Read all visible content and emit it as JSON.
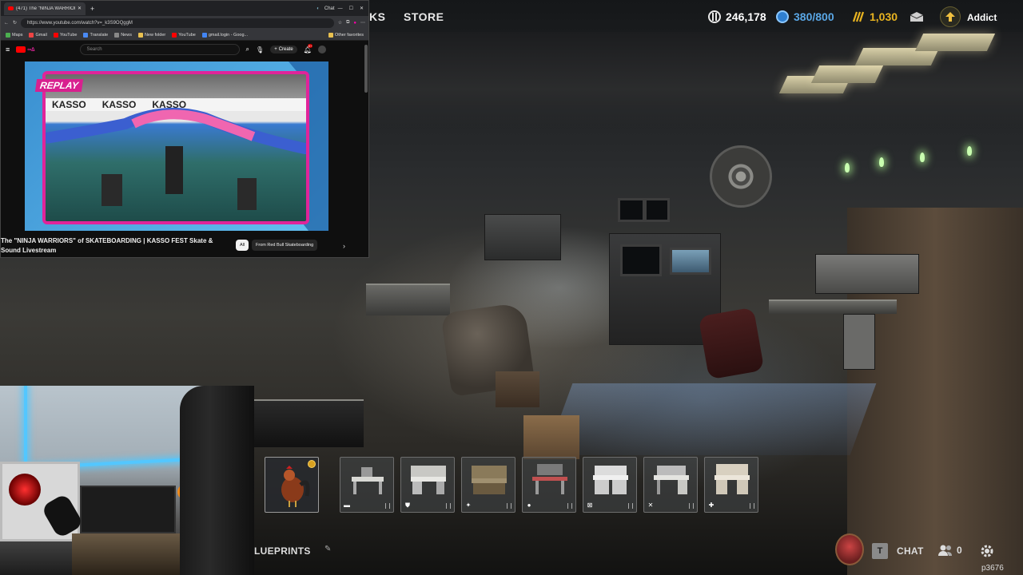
{
  "game": {
    "nav": {
      "partial_tab": "KS",
      "store": "STORE"
    },
    "currencies": [
      {
        "icon": "cod-points-icon",
        "value": "246,178",
        "color": "#e8e8e8"
      },
      {
        "icon": "blue-token-icon",
        "value": "380/800",
        "color": "#5aa7e6"
      },
      {
        "icon": "gold-bars-icon",
        "value": "1,030",
        "color": "#e8b320"
      }
    ],
    "player_level_label": "Addict",
    "slots": [
      {
        "name": "rooster-slot",
        "icon": "",
        "selected": true
      },
      {
        "name": "workbench-slot-1",
        "icon": "▬"
      },
      {
        "name": "workbench-slot-2",
        "icon": "⛊"
      },
      {
        "name": "workbench-slot-3",
        "icon": "✦"
      },
      {
        "name": "workbench-slot-4",
        "icon": "●"
      },
      {
        "name": "workbench-slot-5",
        "icon": "⊠"
      },
      {
        "name": "workbench-slot-6",
        "icon": "✕"
      },
      {
        "name": "workbench-slot-7",
        "icon": "✚"
      }
    ],
    "bottom": {
      "blueprints_label": "LUEPRINTS",
      "chat_key": "T",
      "chat_label": "CHAT",
      "party_count": "0",
      "username": "p3676"
    }
  },
  "browser": {
    "tab_title": "(471) The \"NINJA WARRIORS\"",
    "new_tab": "+",
    "chat_button": "Chat",
    "url": "https://www.youtube.com/watch?v=_k3S9OQggM",
    "bookmarks": [
      "Maps",
      "Gmail",
      "YouTube",
      "Translate",
      "News",
      "New folder",
      "YouTube",
      "gmail.login - Goog..."
    ],
    "other_favorites": "Other favorites",
    "search_placeholder": "Search",
    "create_label": "Create",
    "notification_count": "9+",
    "video": {
      "replay_label": "REPLAY",
      "banner_text": "KASSO",
      "title": "The \"NINJA WARRIORS\" of SKATEBOARDING | KASSO FEST Skate & Sound Livestream"
    },
    "chips": [
      "All",
      "From Red Bull Skateboarding"
    ]
  }
}
